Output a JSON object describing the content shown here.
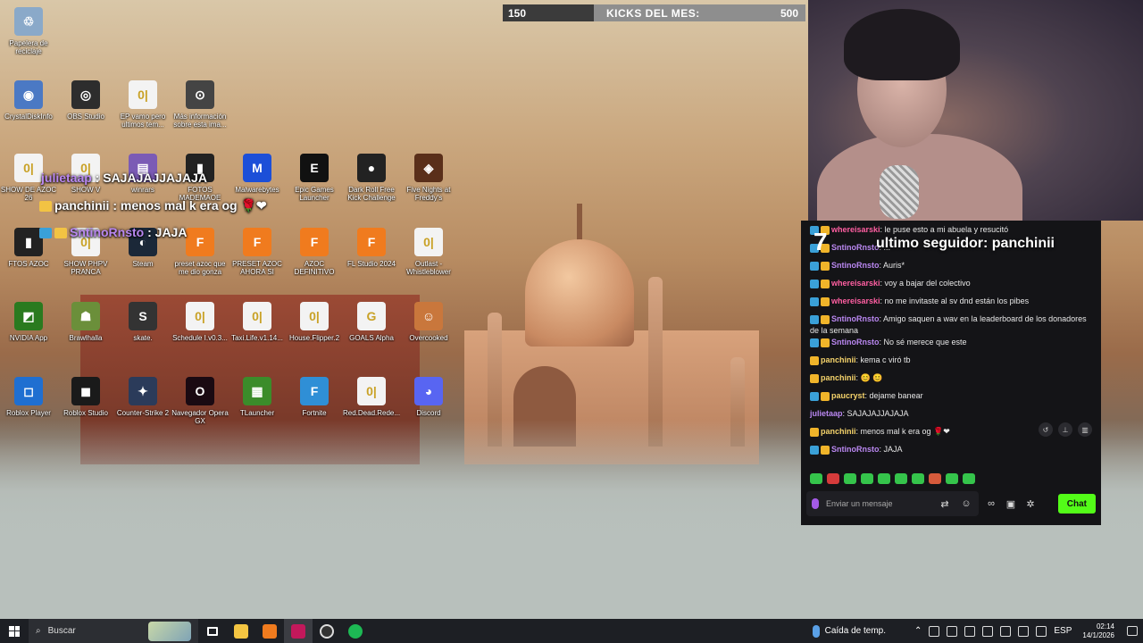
{
  "desktop": {
    "icons": [
      {
        "label": "Papelera de reciclaje",
        "color": "#8aa9c9",
        "glyph": "♲"
      },
      {
        "label": "CrystalDiskInfo",
        "color": "#4b79c4",
        "glyph": "◉"
      },
      {
        "label": "OBS Studio",
        "color": "#2d2d2d",
        "glyph": "◎"
      },
      {
        "label": "EP vamo pero ultimos tem...",
        "color": "#f3f3f3",
        "glyph": "0|"
      },
      {
        "label": "Más información sobre esta ima...",
        "color": "#444444",
        "glyph": "⊙"
      },
      {
        "label": "SHOW DE AZOC 26",
        "color": "#f3f3f3",
        "glyph": "0|"
      },
      {
        "label": "SHOW V",
        "color": "#f3f3f3",
        "glyph": "0|"
      },
      {
        "label": "winrars",
        "color": "#7b5bb5",
        "glyph": "▤"
      },
      {
        "label": "FOTOS MADEMAOE",
        "color": "#222222",
        "glyph": "▮"
      },
      {
        "label": "Malwarebytes",
        "color": "#1c4fd8",
        "glyph": "M"
      },
      {
        "label": "Epic Games Launcher",
        "color": "#111111",
        "glyph": "E"
      },
      {
        "label": "Dark Roll Free Kick Challenge",
        "color": "#222222",
        "glyph": "●"
      },
      {
        "label": "Five Nights at Freddy's",
        "color": "#5a2f1a",
        "glyph": "◈"
      },
      {
        "label": "FTOS AZOC",
        "color": "#222222",
        "glyph": "▮"
      },
      {
        "label": "SHOW PHPV PRANCA",
        "color": "#f3f3f3",
        "glyph": "0|"
      },
      {
        "label": "Steam",
        "color": "#1b2838",
        "glyph": "◐"
      },
      {
        "label": "preset azoc que me dio gonza",
        "color": "#f07b1e",
        "glyph": "F"
      },
      {
        "label": "PRESET AZOC AHORA SI",
        "color": "#f07b1e",
        "glyph": "F"
      },
      {
        "label": "AZOC DEFINITIVO",
        "color": "#f07b1e",
        "glyph": "F"
      },
      {
        "label": "FL Studio 2024",
        "color": "#f07b1e",
        "glyph": "F"
      },
      {
        "label": "Outlast - Whistleblower",
        "color": "#f3f3f3",
        "glyph": "0|"
      },
      {
        "label": "NVIDIA App",
        "color": "#2a7a1f",
        "glyph": "◩"
      },
      {
        "label": "Brawlhalla",
        "color": "#6b8f3a",
        "glyph": "☗"
      },
      {
        "label": "skate.",
        "color": "#333333",
        "glyph": "S"
      },
      {
        "label": "Schedule I.v0.3...",
        "color": "#f3f3f3",
        "glyph": "0|"
      },
      {
        "label": "Taxi.Life.v1.14...",
        "color": "#f3f3f3",
        "glyph": "0|"
      },
      {
        "label": "House.Flipper.2",
        "color": "#f3f3f3",
        "glyph": "0|"
      },
      {
        "label": "GOALS Alpha",
        "color": "#f3f3f3",
        "glyph": "G"
      },
      {
        "label": "Overcooked",
        "color": "#c9773c",
        "glyph": "☺"
      },
      {
        "label": "Roblox Player",
        "color": "#1f6fd1",
        "glyph": "◻"
      },
      {
        "label": "Roblox Studio",
        "color": "#1a1a1a",
        "glyph": "◼"
      },
      {
        "label": "Counter-Strike 2",
        "color": "#2b3b5a",
        "glyph": "✦"
      },
      {
        "label": "Navegador Opera GX",
        "color": "#1a0a12",
        "glyph": "O"
      },
      {
        "label": "TLauncher",
        "color": "#3b8c2a",
        "glyph": "▦"
      },
      {
        "label": "Fortnite",
        "color": "#2f8fd6",
        "glyph": "F"
      },
      {
        "label": "Red.Dead.Rede...",
        "color": "#f3f3f3",
        "glyph": "0|"
      },
      {
        "label": "Discord",
        "color": "#5865f2",
        "glyph": "◕"
      }
    ]
  },
  "kicks_bar": {
    "current": "150",
    "label": "KICKS DEL MES:",
    "goal": "500",
    "progress": 0.3
  },
  "overlay_chat": [
    {
      "user": "julietaap",
      "text": " : SAJAJAJJAJAJA"
    },
    {
      "user": "panchinii",
      "text": " : menos mal k era og 🌹❤"
    },
    {
      "user": "SntinoRnsto",
      "text": " : JAJA"
    }
  ],
  "chat": {
    "seven_label": "7",
    "last_follower": "ultimo seguidor: panchinii",
    "messages": [
      {
        "user": "whereisarski",
        "user_color": "#ff5fa2",
        "text": ": le puse esto a mi abuela y resucitó"
      },
      {
        "user": "SntinoRnsto",
        "user_color": "#b987f0",
        "text": ": ..."
      },
      {
        "user": "SntinoRnsto",
        "user_color": "#b987f0",
        "text": ": Auris*"
      },
      {
        "user": "whereisarski",
        "user_color": "#ff5fa2",
        "text": ": voy a bajar del colectivo"
      },
      {
        "user": "whereisarski",
        "user_color": "#ff5fa2",
        "text": ": no me invitaste al sv dnd están los pibes"
      },
      {
        "user": "SntinoRnsto",
        "user_color": "#b987f0",
        "text": ": Amigo saquen a wav en la leaderboard de los donadores de la semana"
      },
      {
        "user": "SntinoRnsto",
        "user_color": "#b987f0",
        "text": ": No sé merece que este"
      },
      {
        "user": "panchinii",
        "user_color": "#f5d36b",
        "text": ": kema c viró tb"
      },
      {
        "user": "panchinii",
        "user_color": "#f5d36b",
        "text": ": 😊 😊"
      },
      {
        "user": "paucryst",
        "user_color": "#f5d36b",
        "text": ": dejame banear"
      },
      {
        "user": "julietaap",
        "user_color": "#b987f0",
        "text": ": SAJAJAJJAJAJA"
      },
      {
        "user": "panchinii",
        "user_color": "#f5d36b",
        "text": ": menos mal k era og 🌹❤"
      },
      {
        "user": "SntinoRnsto",
        "user_color": "#b987f0",
        "text": ": JAJA"
      }
    ],
    "input_placeholder": "Enviar un mensaje",
    "send_label": "Chat",
    "accent": "#53fc18"
  },
  "taskbar": {
    "search_label": "Buscar",
    "weather": "Caída de temp.",
    "language": "ESP",
    "time": "02:14",
    "date": "14/1/2026"
  }
}
